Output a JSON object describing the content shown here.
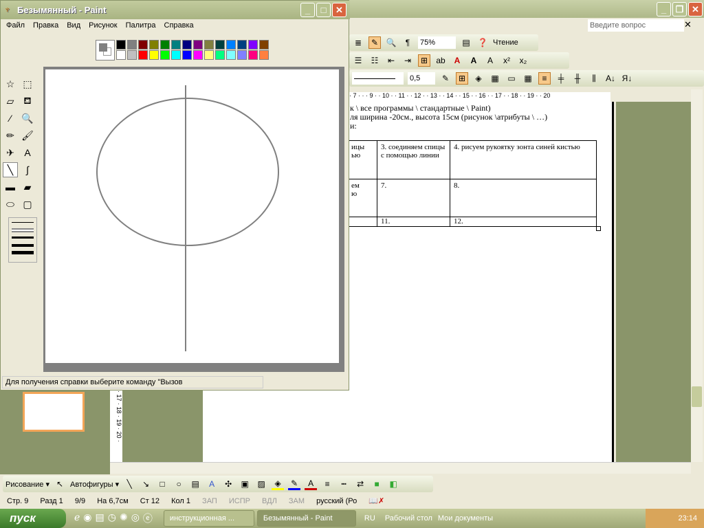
{
  "word": {
    "search_placeholder": "Введите вопрос",
    "zoom": "75%",
    "reading_label": "Чтение",
    "line_weight": "0,5",
    "ruler": "· 7 · · · 9 · · 10 · · 11 · · 12 · · 13 · · 14 · · 15 · · 16 · · 17 · · 18 · · 19 · · 20",
    "vruler": "· 17 · 18 · 19 · 20 ·",
    "doc_lines": [
      "к \\ все программы \\ стандартные  \\ Paint)",
      "ля ширина -20см., высота 15см (рисунок \\атрибуты \\ …)",
      "и:"
    ],
    "table": [
      [
        "ицы\nью",
        "3. соединяем спицы с помощью линии",
        "4. рисуем рукоятку зонта синей кистью"
      ],
      [
        "ем\nю",
        "7.",
        "8."
      ],
      [
        "",
        "11.",
        "12."
      ]
    ],
    "drawing_label": "Рисование ▾",
    "autoshapes_label": "Автофигуры ▾",
    "status": [
      "Стр. 9",
      "Разд 1",
      "9/9",
      "На 6,7см",
      "Ст 12",
      "Кол 1",
      "ЗАП",
      "ИСПР",
      "ВДЛ",
      "ЗАМ",
      "русский (Ро"
    ]
  },
  "paint": {
    "title": "Безымянный - Paint",
    "menu": [
      "Файл",
      "Правка",
      "Вид",
      "Рисунок",
      "Палитра",
      "Справка"
    ],
    "palette_top": [
      "#000000",
      "#808080",
      "#800000",
      "#808000",
      "#008000",
      "#008080",
      "#000080",
      "#800080",
      "#808040",
      "#004040",
      "#0080ff",
      "#004080",
      "#8000ff",
      "#804000"
    ],
    "palette_bottom": [
      "#ffffff",
      "#c0c0c0",
      "#ff0000",
      "#ffff00",
      "#00ff00",
      "#00ffff",
      "#0000ff",
      "#ff00ff",
      "#ffff80",
      "#00ff80",
      "#80ffff",
      "#8080ff",
      "#ff0080",
      "#ff8040"
    ],
    "tools": [
      "free-select",
      "rect-select",
      "eraser",
      "fill",
      "picker",
      "magnifier",
      "pencil",
      "brush",
      "airbrush",
      "text",
      "line",
      "curve",
      "rectangle",
      "polygon",
      "ellipse",
      "rounded-rect"
    ],
    "active_tool": "line",
    "status": "Для получения справки выберите команду \"Вызов"
  },
  "taskbar": {
    "start": "пуск",
    "items": [
      "инструкционная ...",
      "Безымянный - Paint"
    ],
    "lang": "RU",
    "desktop": "Рабочий стол",
    "docs": "Мои документы",
    "clock": "23:14"
  }
}
